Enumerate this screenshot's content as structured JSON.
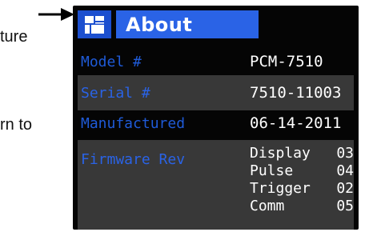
{
  "doc_fragments": [
    "ture",
    "rn to"
  ],
  "screen": {
    "title": "About",
    "icon": "app-grid-icon",
    "rows": {
      "model": {
        "label": "Model #",
        "value": "PCM-7510"
      },
      "serial": {
        "label": "Serial #",
        "value": "7510-11003"
      },
      "manufactured": {
        "label": "Manufactured",
        "value": "06-14-2011"
      },
      "firmware": {
        "label": "Firmware Rev",
        "items": [
          {
            "name": "Display",
            "version": "03"
          },
          {
            "name": "Pulse",
            "version": "04"
          },
          {
            "name": "Trigger",
            "version": "02"
          },
          {
            "name": "Comm",
            "version": "05"
          }
        ]
      }
    }
  },
  "colors": {
    "title_bar": "#2a63e6",
    "icon_bg": "#1c4fcf",
    "label_blue": "#1f5bd8",
    "screen_bg": "#050505",
    "row_highlight": "#383838"
  }
}
